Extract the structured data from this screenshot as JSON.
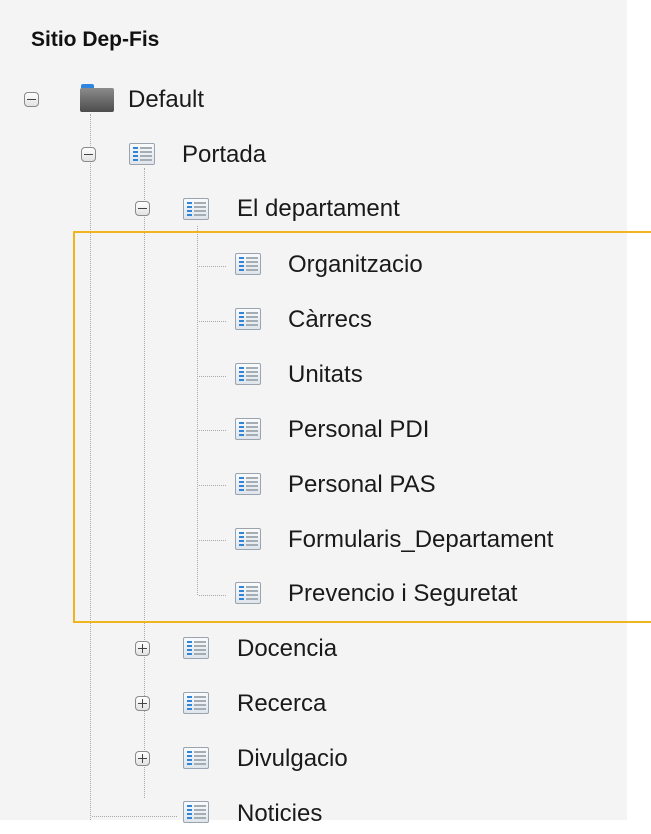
{
  "tree": {
    "title": "Sitio Dep-Fis",
    "root": {
      "label": "Default",
      "icon": "folder-icon",
      "expanded": true
    },
    "portada": {
      "label": "Portada",
      "icon": "page-icon",
      "expanded": true
    },
    "departament": {
      "label": "El departament",
      "icon": "page-icon",
      "expanded": true,
      "children": [
        {
          "label": "Organitzacio"
        },
        {
          "label": "Càrrecs"
        },
        {
          "label": "Unitats"
        },
        {
          "label": "Personal PDI"
        },
        {
          "label": "Personal PAS"
        },
        {
          "label": "Formularis_Departament"
        },
        {
          "label": "Prevencio i Seguretat"
        }
      ]
    },
    "siblings": [
      {
        "label": "Docencia",
        "expanded": false
      },
      {
        "label": "Recerca",
        "expanded": false
      },
      {
        "label": "Divulgacio",
        "expanded": false
      },
      {
        "label": "Noticies"
      }
    ]
  },
  "colors": {
    "highlight": "#f0b51e",
    "panel_background": "#f4f4f4",
    "folder_tab": "#2e86e0"
  }
}
